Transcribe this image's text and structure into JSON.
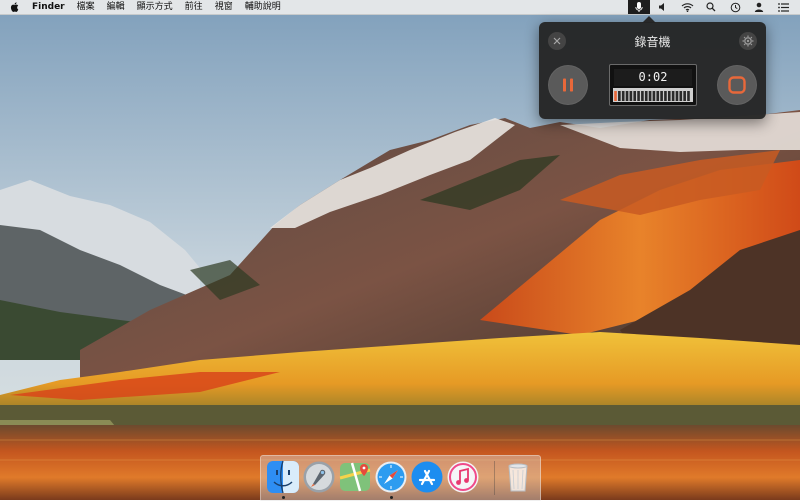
{
  "menubar": {
    "apple_icon": "apple-logo-icon",
    "app_name": "Finder",
    "items": [
      "檔案",
      "編輯",
      "顯示方式",
      "前往",
      "視窗",
      "輔助說明"
    ],
    "status_icons": [
      "microphone-icon",
      "volume-icon",
      "wifi-icon",
      "spotlight-search-icon",
      "time-machine-icon",
      "user-icon",
      "notification-center-icon"
    ]
  },
  "recorder": {
    "title": "錄音機",
    "elapsed": "0:02",
    "level_fraction": 0.05,
    "accent_color": "#e8683a",
    "buttons": [
      "close-icon",
      "gear-icon",
      "pause-icon",
      "stop-icon"
    ]
  },
  "dock": {
    "apps": [
      {
        "name": "finder-icon",
        "running": true
      },
      {
        "name": "launchpad-icon",
        "running": false
      },
      {
        "name": "maps-icon",
        "running": false
      },
      {
        "name": "safari-icon",
        "running": true
      },
      {
        "name": "app-store-icon",
        "running": false
      },
      {
        "name": "itunes-icon",
        "running": false
      }
    ],
    "trash": "trash-icon"
  },
  "wallpaper": {
    "name": "macOS High Sierra mountain lake"
  }
}
